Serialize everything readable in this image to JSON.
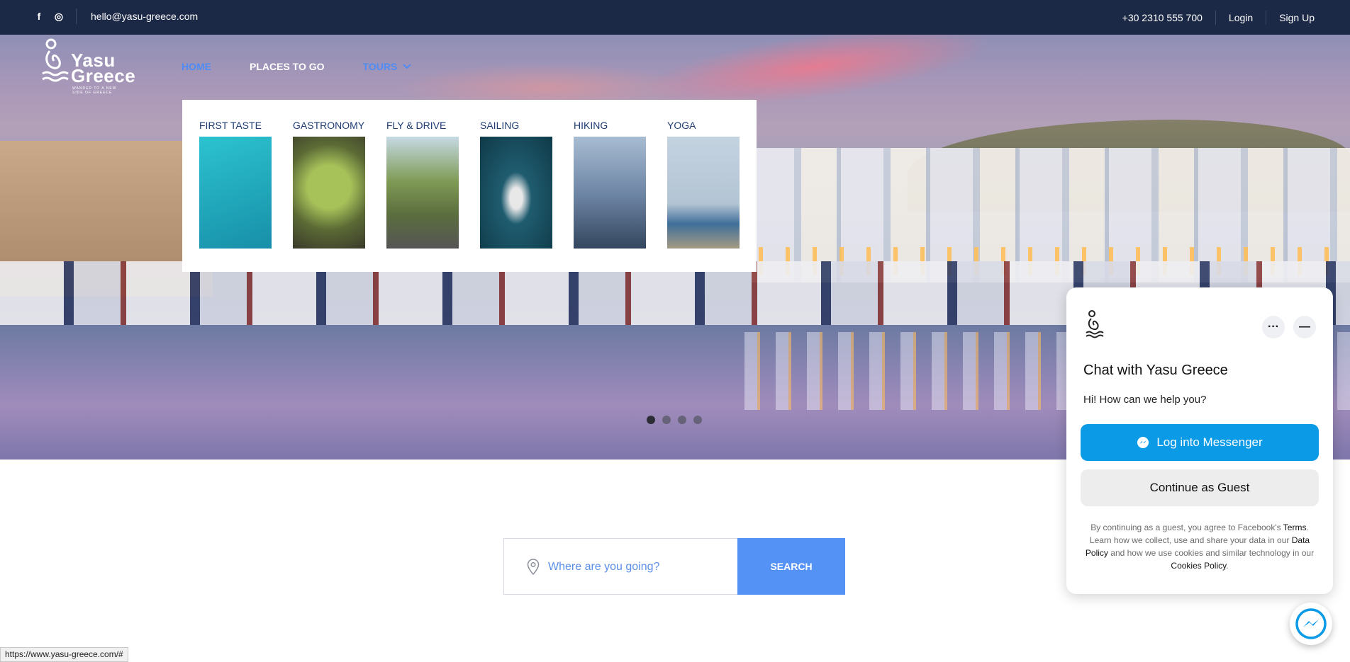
{
  "topbar": {
    "social": [
      {
        "icon": "facebook-icon",
        "glyph": "f"
      },
      {
        "icon": "instagram-icon",
        "glyph": "◎"
      }
    ],
    "email": "hello@yasu-greece.com",
    "phone": "+30 2310 555 700",
    "login": "Login",
    "signup": "Sign Up"
  },
  "logo": {
    "name_line1": "Yasu",
    "name_line2": "Greece",
    "tagline": "WANDER TO A NEW SIDE OF GREECE"
  },
  "nav": {
    "home": "HOME",
    "places": "PLACES TO GO",
    "tours": "TOURS"
  },
  "dropdown": {
    "items": [
      {
        "label": "FIRST TASTE",
        "img_colors": [
          "#25b3c4",
          "#1a9bb3"
        ]
      },
      {
        "label": "GASTRONOMY",
        "img_colors": [
          "#7fa34a",
          "#4b5d2c"
        ]
      },
      {
        "label": "FLY & DRIVE",
        "img_colors": [
          "#a8c3cf",
          "#5c6b45"
        ]
      },
      {
        "label": "SAILING",
        "img_colors": [
          "#1f5c6f",
          "#0f3a48"
        ]
      },
      {
        "label": "HIKING",
        "img_colors": [
          "#8ba2bd",
          "#3c5270"
        ]
      },
      {
        "label": "YOGA",
        "img_colors": [
          "#b6c7d8",
          "#9d8f7a"
        ]
      }
    ]
  },
  "carousel": {
    "dots": 4,
    "active": 0
  },
  "search": {
    "placeholder": "Where are you going?",
    "button": "SEARCH"
  },
  "chat": {
    "title": "Chat with Yasu Greece",
    "greeting": "Hi! How can we help you?",
    "login_button": "Log into Messenger",
    "guest_button": "Continue as Guest",
    "legal_1": "By continuing as a guest, you agree to Facebook's",
    "terms": "Terms",
    "legal_2": ". Learn how we collect, use and share your data in our",
    "data_policy": "Data Policy",
    "legal_3": "and how we use cookies and similar technology in our",
    "cookies_policy": "Cookies Policy",
    "legal_4": ".",
    "more_glyph": "···",
    "minimize_glyph": "—"
  },
  "status_url": "https://www.yasu-greece.com/#",
  "colors": {
    "topbar": "#1b2846",
    "accent": "#5592f5",
    "messenger": "#0a9ae6"
  }
}
